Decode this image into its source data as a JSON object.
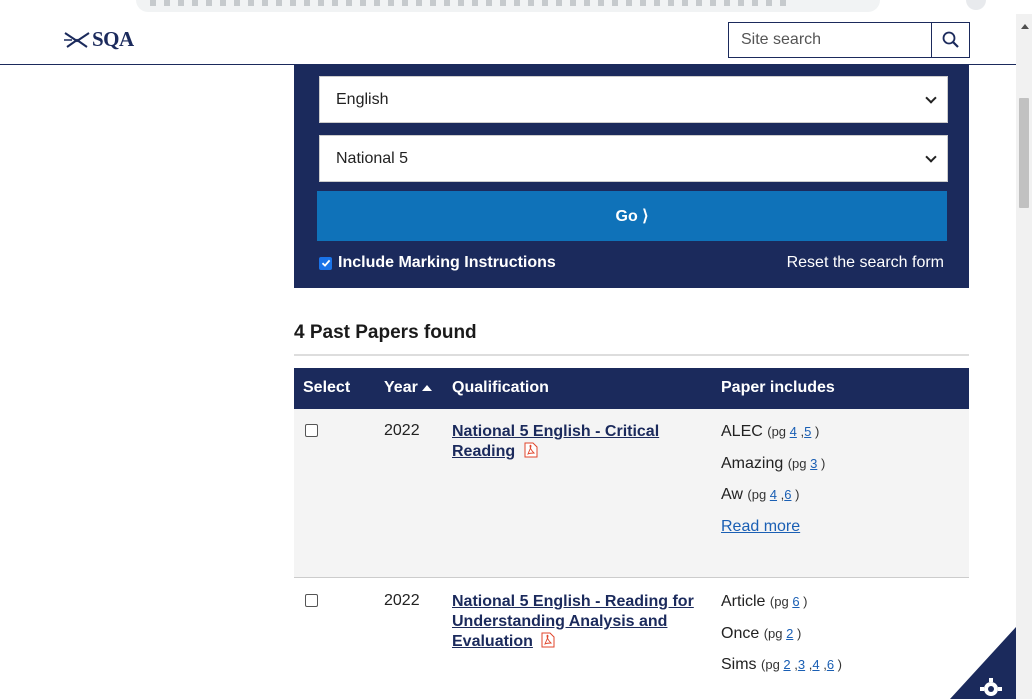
{
  "header": {
    "logo_text": "SQA",
    "search_placeholder": "Site search"
  },
  "search_form": {
    "subject_selected": "English",
    "level_selected": "National 5",
    "go_label": "Go ⟩",
    "include_marking_label": "Include Marking Instructions",
    "include_marking_checked": true,
    "reset_label": "Reset the search form"
  },
  "results": {
    "heading": "4 Past Papers found",
    "columns": {
      "select": "Select",
      "year": "Year",
      "qualification": "Qualification",
      "includes": "Paper includes"
    },
    "rows": [
      {
        "year": "2022",
        "qualification": "National 5 English - Critical Reading",
        "includes": [
          {
            "term": "ALEC",
            "pages": [
              "4",
              "5"
            ]
          },
          {
            "term": "Amazing",
            "pages": [
              "3"
            ]
          },
          {
            "term": "Aw",
            "pages": [
              "4",
              "6"
            ]
          }
        ],
        "read_more": "Read more"
      },
      {
        "year": "2022",
        "qualification": "National 5 English - Reading for Understanding Analysis and Evaluation",
        "includes": [
          {
            "term": "Article",
            "pages": [
              "6"
            ]
          },
          {
            "term": "Once",
            "pages": [
              "2"
            ]
          },
          {
            "term": "Sims",
            "pages": [
              "2",
              "3",
              "4",
              "6"
            ]
          }
        ]
      }
    ]
  },
  "colors": {
    "navy": "#1b2a5c",
    "go_blue": "#0f72b9",
    "link_blue": "#1a5fb4",
    "pdf_red": "#e0452b"
  }
}
